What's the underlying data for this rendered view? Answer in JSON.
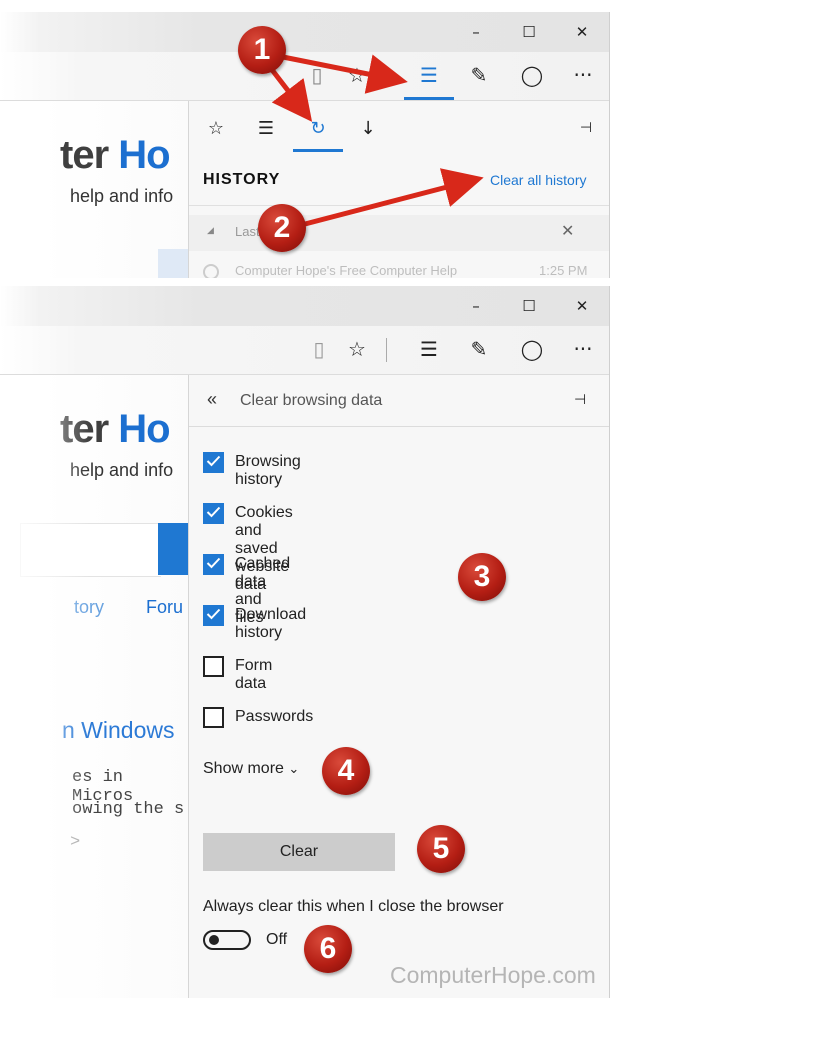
{
  "window_controls": {
    "minimize": "–",
    "maximize": "☐",
    "close": "✕"
  },
  "top_window": {
    "hub_tabs": {
      "favorites": "☆",
      "reading_list": "☰",
      "history": "↻",
      "downloads": "↓",
      "pin": "⊣"
    },
    "history_header": "HISTORY",
    "clear_all_link": "Clear all history",
    "group_label": "Last",
    "group_close": "✕",
    "entry_title": "Computer Hope's Free Computer Help",
    "entry_time": "1:25 PM"
  },
  "toolbar": {
    "reading_view": "▯",
    "favorite": "☆",
    "hub": "☰",
    "web_note": "✎",
    "share": "◯",
    "more": "···"
  },
  "page_behind": {
    "brand_gray": "ter",
    "brand_blue": "Ho",
    "tagline": "help and info",
    "nav_history": "tory",
    "nav_forum": "Foru",
    "heading": "n Windows",
    "code_line1": "es in Micros",
    "code_line2": "owing the s",
    "code_arrow": ">"
  },
  "clear_panel": {
    "back_icon": "«",
    "title": "Clear browsing data",
    "pin": "⊣",
    "options": [
      {
        "label": "Browsing history",
        "checked": true
      },
      {
        "label": "Cookies and saved website data",
        "checked": true
      },
      {
        "label": "Cached data and files",
        "checked": true
      },
      {
        "label": "Download history",
        "checked": true
      },
      {
        "label": "Form data",
        "checked": false
      },
      {
        "label": "Passwords",
        "checked": false
      }
    ],
    "show_more": "Show more",
    "show_more_chevron": "⌄",
    "clear_button": "Clear",
    "always_clear_label": "Always clear this when I close the browser",
    "toggle_state": "Off"
  },
  "markers": [
    "1",
    "2",
    "3",
    "4",
    "5",
    "6"
  ],
  "watermark": "ComputerHope.com",
  "colors": {
    "accent": "#1f78d2",
    "marker_red": "#b41e14",
    "brand_blue": "#1c6fd0"
  }
}
